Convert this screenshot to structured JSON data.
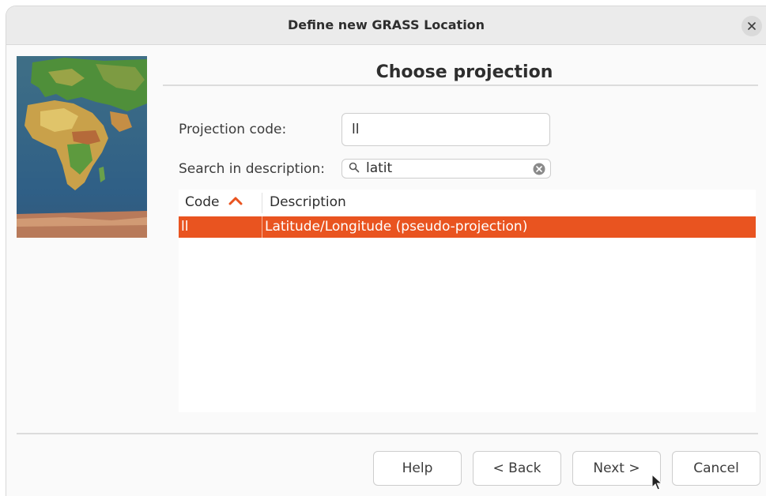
{
  "window": {
    "title": "Define new GRASS Location"
  },
  "page": {
    "heading": "Choose projection"
  },
  "form": {
    "projection_code_label": "Projection code:",
    "projection_code_value": "ll",
    "search_label": "Search in description:",
    "search_value": "latit"
  },
  "table": {
    "columns": [
      "Code",
      "Description"
    ],
    "sort_column": "Code",
    "sort_direction": "ascending",
    "rows": [
      {
        "code": "ll",
        "description": "Latitude/Longitude (pseudo-projection)",
        "selected": true
      }
    ]
  },
  "buttons": {
    "help": "Help",
    "back": "< Back",
    "next": "Next >",
    "cancel": "Cancel"
  },
  "icons": {
    "close": "close-icon",
    "search": "search-icon",
    "clear": "clear-icon",
    "sort": "chevron-up-icon"
  },
  "colors": {
    "accent": "#e95420",
    "titlebar": "#ebebeb",
    "background": "#fafafa"
  }
}
